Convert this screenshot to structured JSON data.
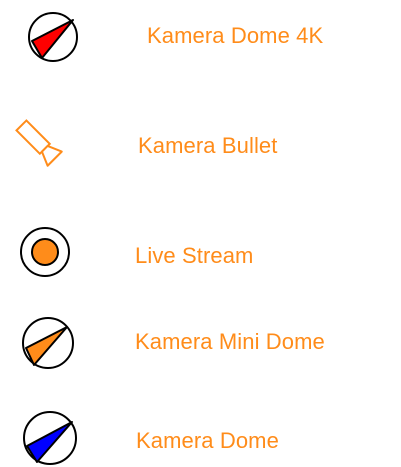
{
  "legend": {
    "items": [
      {
        "label": "Kamera Dome 4K",
        "icon": "dome-camera-icon",
        "color": "#ff0000"
      },
      {
        "label": "Kamera Bullet",
        "icon": "bullet-camera-icon",
        "color": "#ff8c1a"
      },
      {
        "label": "Live Stream",
        "icon": "live-stream-icon",
        "color": "#ff8c1a"
      },
      {
        "label": "Kamera Mini Dome",
        "icon": "mini-dome-camera-icon",
        "color": "#ff8c1a"
      },
      {
        "label": "Kamera Dome",
        "icon": "dome-camera-icon",
        "color": "#0000ff"
      }
    ],
    "text_color": "#ff8c1a"
  }
}
